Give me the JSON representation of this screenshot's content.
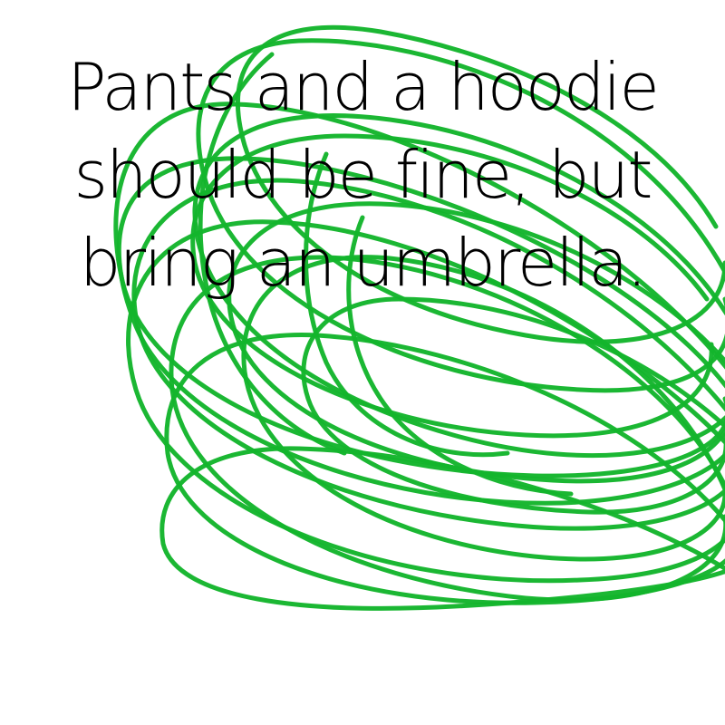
{
  "message": {
    "lines": [
      "Pants and a hoodie",
      "should be fine, but",
      "bring an umbrella."
    ]
  },
  "colors": {
    "background": "#ffffff",
    "text": "#000000",
    "scribble": "#14b52c"
  }
}
